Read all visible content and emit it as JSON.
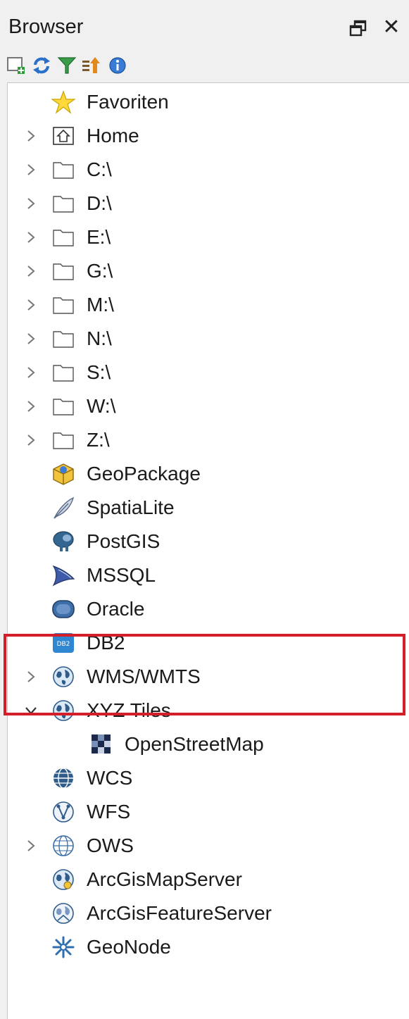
{
  "panel": {
    "title": "Browser",
    "float_icon": "float-window-icon",
    "close_glyph": "✕"
  },
  "toolbar": {
    "buttons": [
      "add-layer-icon",
      "refresh-icon",
      "filter-icon",
      "collapse-all-icon",
      "properties-icon"
    ]
  },
  "tree": {
    "items": [
      {
        "label": "Favoriten",
        "icon": "star-icon"
      },
      {
        "label": "Home",
        "icon": "home-folder-icon"
      },
      {
        "label": "C:\\",
        "icon": "folder-icon"
      },
      {
        "label": "D:\\",
        "icon": "folder-icon"
      },
      {
        "label": "E:\\",
        "icon": "folder-icon"
      },
      {
        "label": "G:\\",
        "icon": "folder-icon"
      },
      {
        "label": "M:\\",
        "icon": "folder-icon"
      },
      {
        "label": "N:\\",
        "icon": "folder-icon"
      },
      {
        "label": "S:\\",
        "icon": "folder-icon"
      },
      {
        "label": "W:\\",
        "icon": "folder-icon"
      },
      {
        "label": "Z:\\",
        "icon": "folder-icon"
      },
      {
        "label": "GeoPackage",
        "icon": "geopackage-icon"
      },
      {
        "label": "SpatiaLite",
        "icon": "feather-icon"
      },
      {
        "label": "PostGIS",
        "icon": "elephant-icon"
      },
      {
        "label": "MSSQL",
        "icon": "mssql-icon"
      },
      {
        "label": "Oracle",
        "icon": "oracle-icon"
      },
      {
        "label": "DB2",
        "icon": "db2-icon"
      },
      {
        "label": "WMS/WMTS",
        "icon": "globe-icon"
      },
      {
        "label": "XYZ Tiles",
        "icon": "globe-icon"
      },
      {
        "label": "OpenStreetMap",
        "icon": "tiles-icon"
      },
      {
        "label": "WCS",
        "icon": "wcs-globe-icon"
      },
      {
        "label": "WFS",
        "icon": "wfs-globe-icon"
      },
      {
        "label": "OWS",
        "icon": "ows-globe-icon"
      },
      {
        "label": "ArcGisMapServer",
        "icon": "arcgis-map-globe-icon"
      },
      {
        "label": "ArcGisFeatureServer",
        "icon": "arcgis-feature-globe-icon"
      },
      {
        "label": "GeoNode",
        "icon": "geonode-icon"
      }
    ]
  },
  "colors": {
    "highlight": "#d41f2b",
    "panel_bg": "#f0f0f0",
    "tree_bg": "#ffffff"
  }
}
